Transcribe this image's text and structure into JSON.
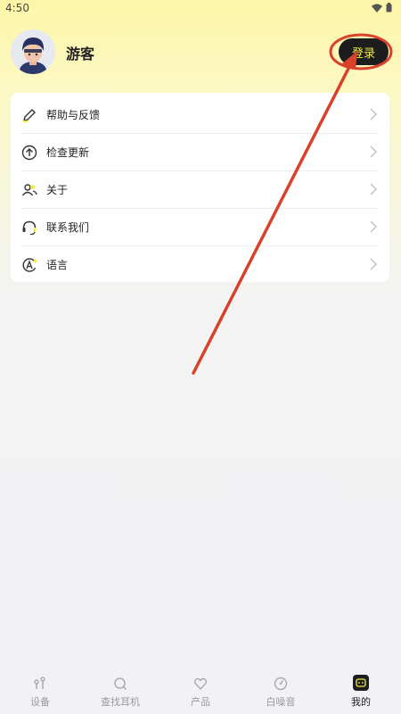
{
  "status_bar": {
    "time": "4:50"
  },
  "profile": {
    "username": "游客",
    "login_label": "登录"
  },
  "menu": [
    {
      "label": "帮助与反馈",
      "icon": "edit-icon"
    },
    {
      "label": "检查更新",
      "icon": "upload-arrow-icon"
    },
    {
      "label": "关于",
      "icon": "users-icon"
    },
    {
      "label": "联系我们",
      "icon": "headset-icon"
    },
    {
      "label": "语言",
      "icon": "language-icon"
    }
  ],
  "tabs": [
    {
      "label": "设备",
      "icon": "device-icon"
    },
    {
      "label": "查找耳机",
      "icon": "search-earbuds-icon"
    },
    {
      "label": "产品",
      "icon": "product-icon"
    },
    {
      "label": "白噪音",
      "icon": "white-noise-icon"
    },
    {
      "label": "我的",
      "icon": "profile-icon",
      "active": true
    }
  ],
  "colors": {
    "accent": "#f3e948",
    "dark": "#1d1d1d",
    "annotation": "#d9412b"
  }
}
